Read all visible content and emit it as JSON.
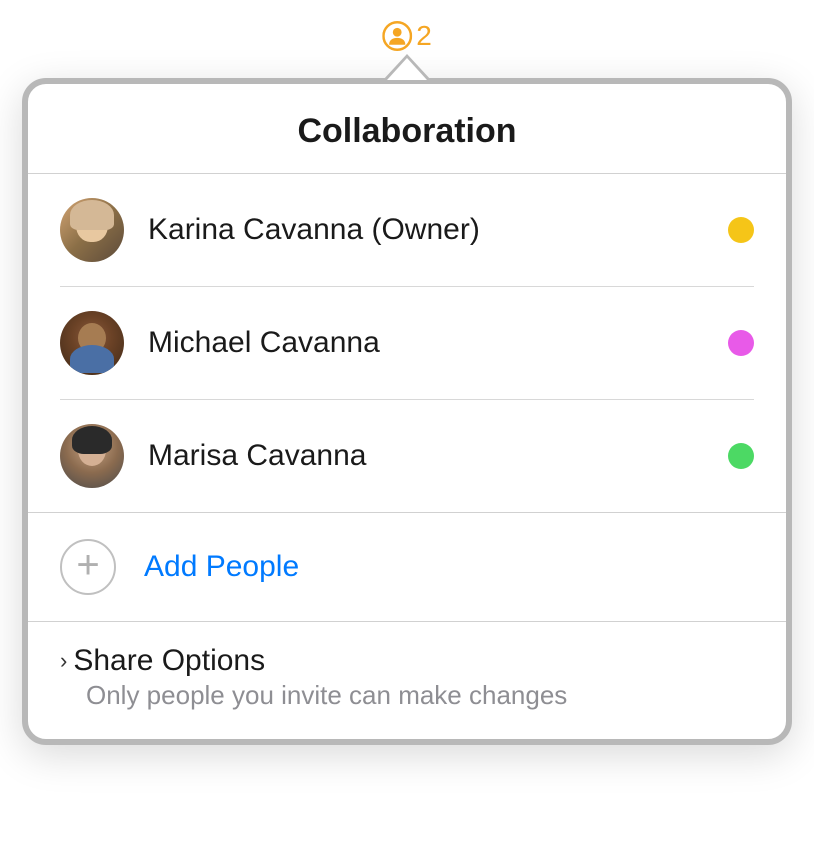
{
  "indicator": {
    "count": "2",
    "color": "#f5a623"
  },
  "popover": {
    "title": "Collaboration",
    "participants": [
      {
        "name": "Karina Cavanna (Owner)",
        "status_color": "#f5c518"
      },
      {
        "name": "Michael Cavanna",
        "status_color": "#e85ae8"
      },
      {
        "name": "Marisa Cavanna",
        "status_color": "#4cd964"
      }
    ],
    "add_people_label": "Add People",
    "share_options": {
      "title": "Share Options",
      "subtitle": "Only people you invite can make changes"
    },
    "link_color": "#007aff"
  }
}
